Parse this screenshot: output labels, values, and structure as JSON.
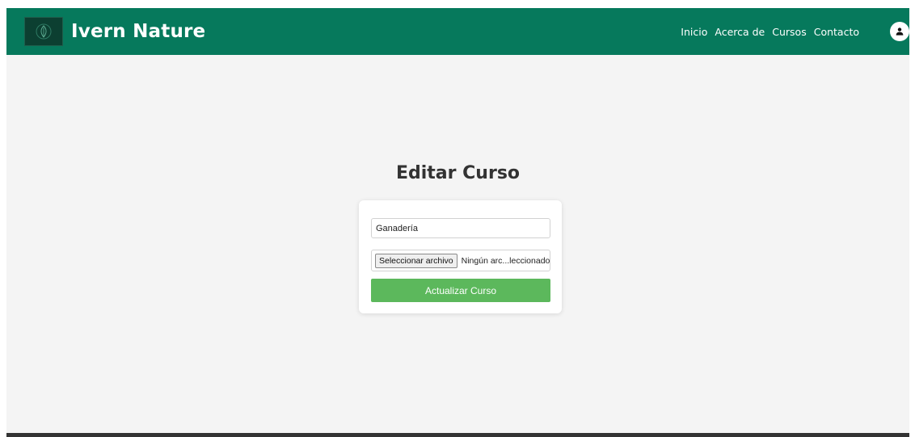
{
  "header": {
    "brand_title": "Ivern Nature",
    "nav": [
      {
        "label": "Inicio"
      },
      {
        "label": "Acerca de"
      },
      {
        "label": "Cursos"
      },
      {
        "label": "Contacto"
      }
    ],
    "icons": {
      "logo": "leaf-logo-icon",
      "avatar": "user-icon"
    },
    "colors": {
      "navbar": "#06795c",
      "page_background": "#f4f4f4",
      "primary_button": "#5cb85c",
      "footer": "#333333"
    }
  },
  "main": {
    "title": "Editar Curso",
    "form": {
      "course_name_value": "Ganadería",
      "file_button_label": "Seleccionar archivo",
      "file_status": "Ningún arc...leccionado",
      "submit_label": "Actualizar Curso"
    }
  }
}
